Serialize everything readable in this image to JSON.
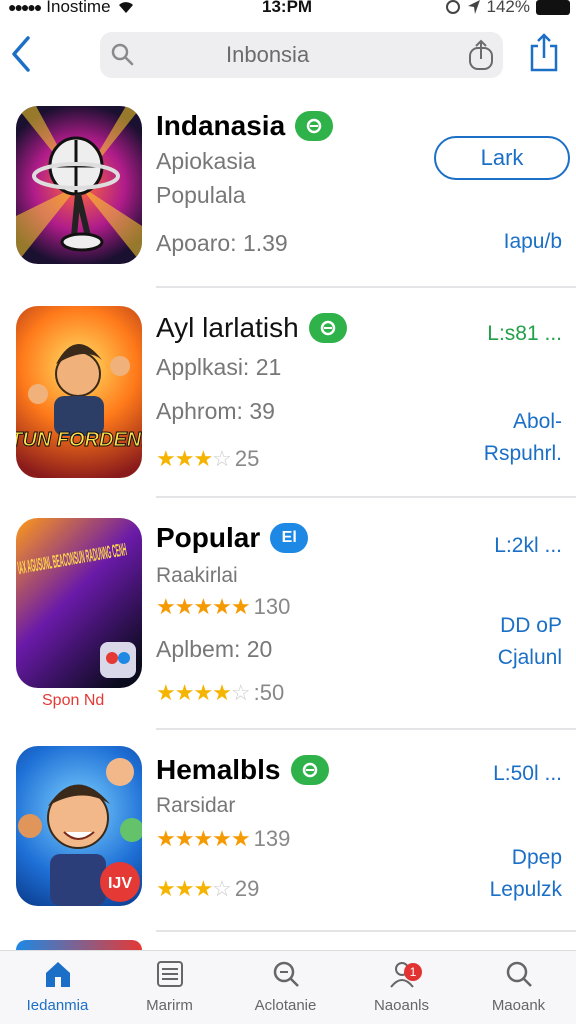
{
  "status": {
    "carrier": "Inostime",
    "time": "13:PM",
    "battery": "142%"
  },
  "search": {
    "text": "Inbonsia"
  },
  "apps": [
    {
      "title": "Indanasia",
      "line1": "Apiokasia",
      "line2": "Populala",
      "line3": "Apoaro: 1.39",
      "button": "Lark",
      "right": "Iapu/b"
    },
    {
      "title": "Ayl larlatish",
      "line1": "Applkasi: 21",
      "line2": "Aphrom: 39",
      "rating": 3.5,
      "rating_text": "25",
      "right_top": "L:s81 ...",
      "right1": "Abol-",
      "right2": "Rspuhrl.",
      "icon_text": "TUN FORDEN!"
    },
    {
      "title": "Popular",
      "badge": "El",
      "line1": "Raakirlai",
      "rating1": 5,
      "rating1_text": "130",
      "line2": "Aplbem: 20",
      "rating2": 4,
      "rating2_text": ":50",
      "right_top": "L:2kl ...",
      "right1": "DD oP",
      "right2": "Cjalunl",
      "icon_text": "IAX AGUSUNL BEACONSUN RADUNNG CENH",
      "caption": "Spon Nd"
    },
    {
      "title": "Hemalbls",
      "line1": "Rarsidar",
      "rating1": 5,
      "rating1_text": "139",
      "rating2": 3.5,
      "rating2_text": "29",
      "right_top": "L:50l ...",
      "right1": "Dpep",
      "right2": "Lepulzk",
      "icon_text": "IJV"
    }
  ],
  "tabs": [
    {
      "label": "Iedanmia",
      "icon": "home-icon"
    },
    {
      "label": "Marirm",
      "icon": "list-icon"
    },
    {
      "label": "Aclotanie",
      "icon": "search-icon"
    },
    {
      "label": "Naoanls",
      "icon": "person-icon",
      "badge": "1"
    },
    {
      "label": "Maoank",
      "icon": "search-icon"
    }
  ]
}
